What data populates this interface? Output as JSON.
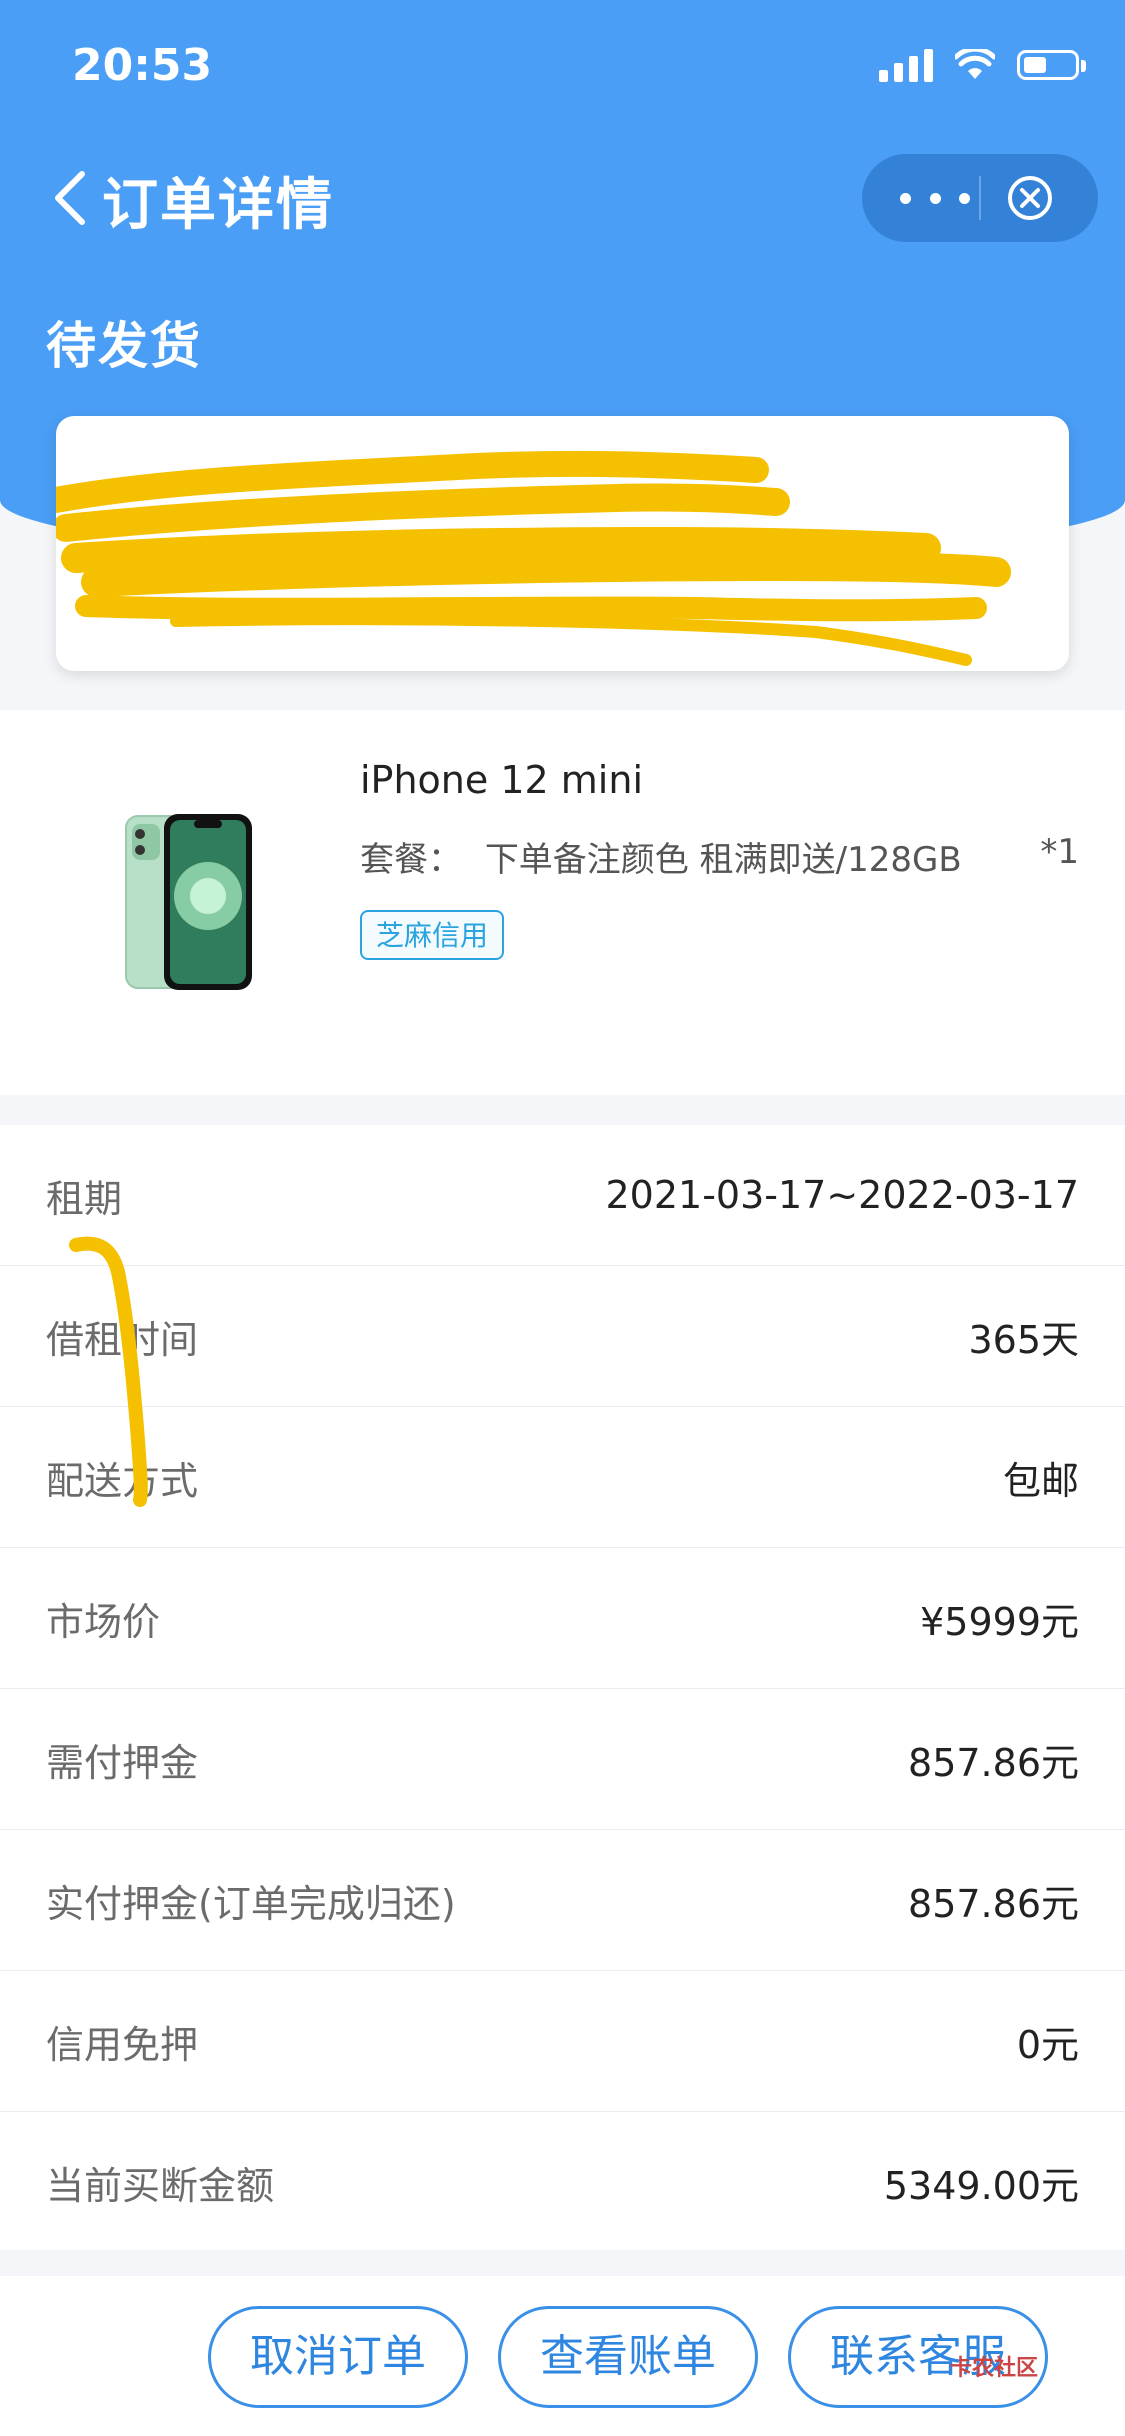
{
  "status_bar": {
    "time": "20:53"
  },
  "nav": {
    "title": "订单详情"
  },
  "order": {
    "status": "待发货"
  },
  "product": {
    "name": "iPhone 12 mini",
    "package_label": "套餐：",
    "package_value": "下单备注颜色 租满即送/128GB",
    "quantity": "*1",
    "tag": "芝麻信用"
  },
  "details": [
    {
      "label": "租期",
      "value": "2021-03-17~2022-03-17"
    },
    {
      "label": "借租时间",
      "value": "365天"
    },
    {
      "label": "配送方式",
      "value": "包邮"
    },
    {
      "label": "市场价",
      "value": "¥5999元"
    },
    {
      "label": "需付押金",
      "value": "857.86元"
    },
    {
      "label": "实付押金(订单完成归还)",
      "value": "857.86元"
    },
    {
      "label": "信用免押",
      "value": "0元"
    },
    {
      "label": "当前买断金额",
      "value": "5349.00元"
    }
  ],
  "actions": {
    "cancel": "取消订单",
    "bill": "查看账单",
    "service": "联系客服"
  },
  "watermark": "卡农社区",
  "colors": {
    "header": "#4a9ef5",
    "accent": "#2f86e0",
    "redaction": "#f5c000",
    "tag": "#2aa4de"
  }
}
